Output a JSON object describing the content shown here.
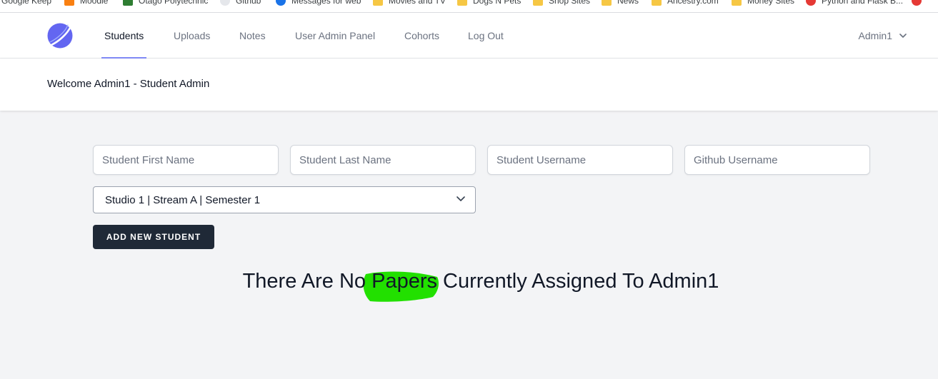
{
  "bookmarks": [
    {
      "label": "Google Keep",
      "icon": "keep-icon",
      "color": "#f6b400"
    },
    {
      "label": "Moodle",
      "icon": "moodle-icon",
      "color": "#f98012"
    },
    {
      "label": "Otago Polytechnic",
      "icon": "otago-icon",
      "color": "#2e7d32"
    },
    {
      "label": "Github",
      "icon": "github-icon",
      "color": "#ffffff"
    },
    {
      "label": "Messages for web",
      "icon": "messages-icon",
      "color": "#1a73e8"
    },
    {
      "label": "Movies and TV",
      "icon": "folder-icon",
      "color": "#f6c744"
    },
    {
      "label": "Dogs N Pets",
      "icon": "folder-icon",
      "color": "#f6c744"
    },
    {
      "label": "Shop Sites",
      "icon": "folder-icon",
      "color": "#f6c744"
    },
    {
      "label": "News",
      "icon": "folder-icon",
      "color": "#f6c744"
    },
    {
      "label": "Ancestry.com",
      "icon": "folder-icon",
      "color": "#f6c744"
    },
    {
      "label": "Money Sites",
      "icon": "folder-icon",
      "color": "#f6c744"
    },
    {
      "label": "Python and Flask B...",
      "icon": "flask-icon",
      "color": "#e53935"
    }
  ],
  "nav": {
    "items": [
      {
        "label": "Students",
        "active": true
      },
      {
        "label": "Uploads",
        "active": false
      },
      {
        "label": "Notes",
        "active": false
      },
      {
        "label": "User Admin Panel",
        "active": false
      },
      {
        "label": "Cohorts",
        "active": false
      },
      {
        "label": "Log Out",
        "active": false
      }
    ],
    "user": "Admin1",
    "accent": "#818cf8"
  },
  "header": {
    "title": "Welcome Admin1 - Student Admin"
  },
  "form": {
    "first_name_placeholder": "Student First Name",
    "last_name_placeholder": "Student Last Name",
    "username_placeholder": "Student Username",
    "github_placeholder": "Github Username",
    "cohort_selected": "Studio 1 | Stream A | Semester 1",
    "add_button": "ADD NEW STUDENT"
  },
  "message": "There Are No Papers Currently Assigned To Admin1",
  "colors": {
    "background": "#f3f4f6",
    "button": "#1f2937",
    "highlight": "#22e000"
  }
}
